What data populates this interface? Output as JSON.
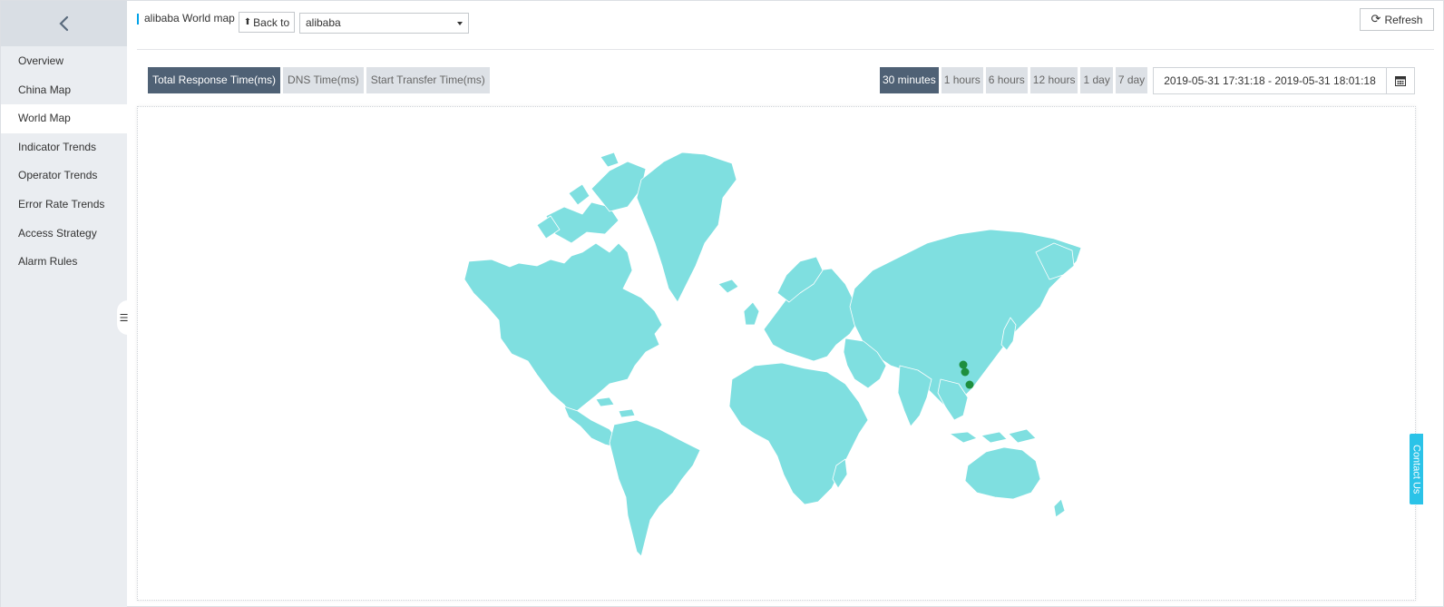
{
  "sidebar": {
    "back_icon": "chevron-left-icon",
    "items": [
      {
        "label": "Overview",
        "active": false
      },
      {
        "label": "China Map",
        "active": false
      },
      {
        "label": "World Map",
        "active": true
      },
      {
        "label": "Indicator Trends",
        "active": false
      },
      {
        "label": "Operator Trends",
        "active": false
      },
      {
        "label": "Error Rate Trends",
        "active": false
      },
      {
        "label": "Access Strategy",
        "active": false
      },
      {
        "label": "Alarm Rules",
        "active": false
      }
    ],
    "collapse_icon": "menu-collapse-icon",
    "collapse_glyph": "☰"
  },
  "header": {
    "title": "alibaba World map",
    "back_label": "Back to",
    "back_glyph": "⬆",
    "select_value": "alibaba",
    "refresh_label": "Refresh",
    "refresh_glyph": "⟳"
  },
  "metric_tabs": [
    {
      "label": "Total Response Time(ms)",
      "active": true
    },
    {
      "label": "DNS Time(ms)",
      "active": false
    },
    {
      "label": "Start Transfer Time(ms)",
      "active": false
    }
  ],
  "time_tabs": [
    {
      "label": "30 minutes",
      "active": true
    },
    {
      "label": "1 hours",
      "active": false
    },
    {
      "label": "6 hours",
      "active": false
    },
    {
      "label": "12 hours",
      "active": false
    },
    {
      "label": "1 day",
      "active": false
    },
    {
      "label": "7 day",
      "active": false
    }
  ],
  "date_range": "2019-05-31 17:31:18 - 2019-05-31 18:01:18",
  "map": {
    "land_color": "#7fdfe0",
    "border_color": "#ffffff",
    "marker_color": "#1e8f3e",
    "marker_count": 3
  },
  "contact_label": "Contact Us",
  "colors": {
    "accent": "#4f6175",
    "contact": "#2bc3e8",
    "sidebar_bg": "#eaedf1"
  }
}
